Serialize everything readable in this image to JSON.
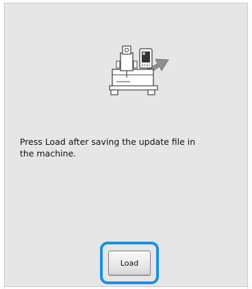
{
  "dialog": {
    "message": "Press Load after saving the update file in\nthe machine.",
    "load_label": "Load"
  },
  "illustration": {
    "icon": "embroidery-machine-update-icon",
    "arrow_color": "#8a8a8a",
    "screen_color": "#333333"
  },
  "colors": {
    "background": "#e6e6e6",
    "focus_ring": "#1a8fe8"
  }
}
